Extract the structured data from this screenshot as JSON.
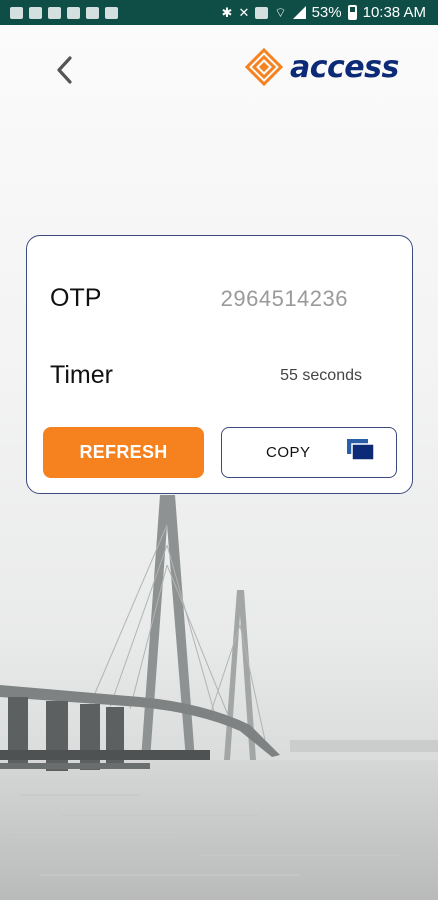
{
  "status_bar": {
    "battery": "53%",
    "time": "10:38 AM",
    "color": "#0e4e46"
  },
  "header": {
    "back_icon": "chevron-left-icon",
    "logo_text": "access",
    "logo_color": "#0c2a76",
    "logo_accent": "#f5811f"
  },
  "otp_card": {
    "otp_label": "OTP",
    "otp_value": "2964514236",
    "timer_label": "Timer",
    "timer_value": "55 seconds",
    "refresh_label": "REFRESH",
    "copy_label": "COPY",
    "copy_icon": "copy-icon",
    "refresh_color": "#f5811f",
    "border_color": "#3c4a7d"
  }
}
